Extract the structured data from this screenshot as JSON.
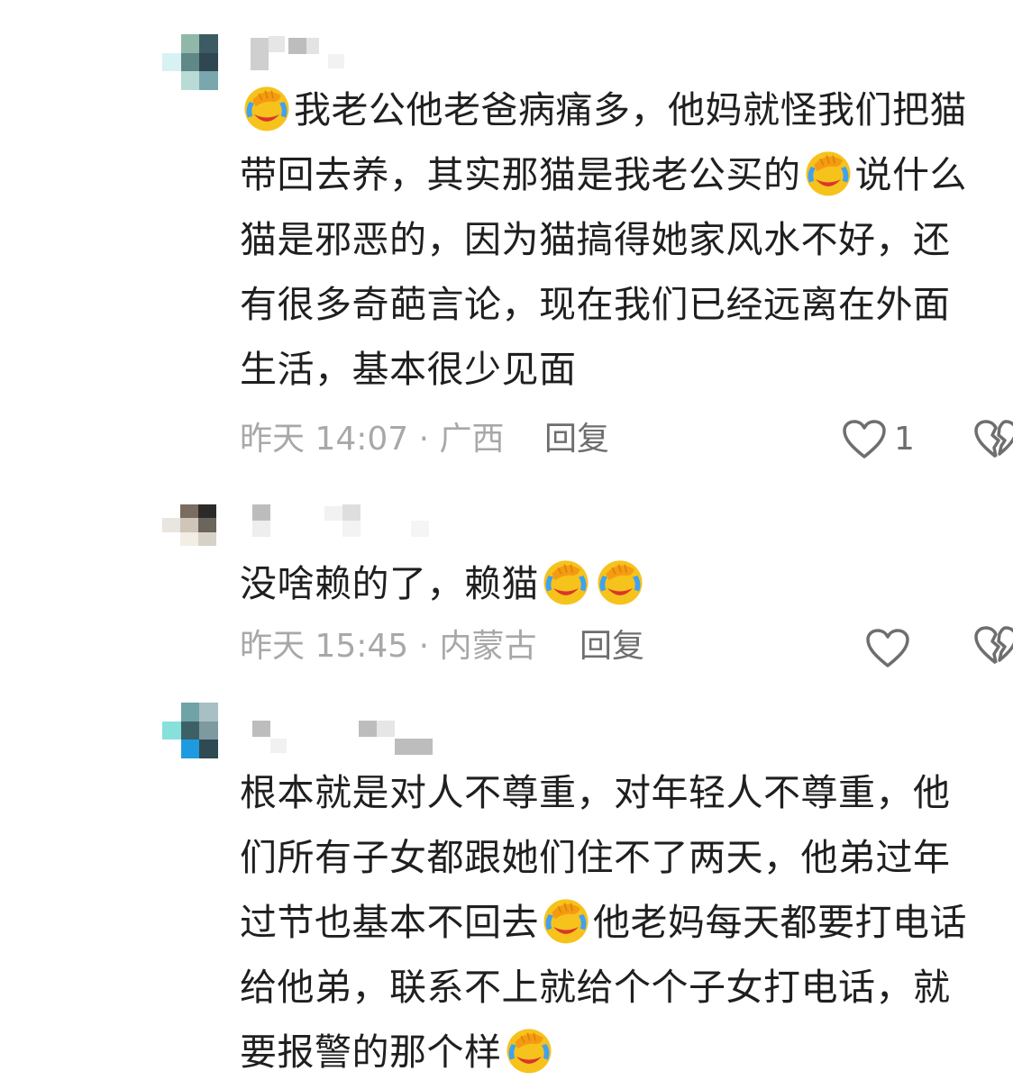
{
  "comments": [
    {
      "lines": [
        {
          "before": "",
          "emoji": "facepalm-laugh",
          "after": "我老公他老爸病痛多，他妈就怪我们把猫"
        },
        {
          "before": "带回去养，其实那猫是我老公买的",
          "emoji": "facepalm-laugh",
          "after": "说什么"
        },
        {
          "before": "猫是邪恶的，因为猫搞得她家风水不好，还",
          "emoji": "",
          "after": ""
        },
        {
          "before": "有很多奇葩言论，现在我们已经远离在外面",
          "emoji": "",
          "after": ""
        },
        {
          "before": "生活，基本很少见面",
          "emoji": "",
          "after": ""
        }
      ],
      "meta": "昨天 14:07 · 广西",
      "reply_label": "回复",
      "like_count": "1"
    },
    {
      "lines": [
        {
          "before": "没啥赖的了，赖猫",
          "emoji": "facepalm-laugh",
          "emoji2": "facepalm-laugh",
          "after": ""
        }
      ],
      "meta": "昨天 15:45 · 内蒙古",
      "reply_label": "回复",
      "like_count": ""
    },
    {
      "lines": [
        {
          "before": "根本就是对人不尊重，对年轻人不尊重，他",
          "emoji": "",
          "after": ""
        },
        {
          "before": "们所有子女都跟她们住不了两天，他弟过年",
          "emoji": "",
          "after": ""
        },
        {
          "before": "过节也基本不回去",
          "emoji": "facepalm-laugh",
          "after": "他老妈每天都要打电话"
        },
        {
          "before": "给他弟，联系不上就给个个子女打电话，就",
          "emoji": "",
          "after": ""
        },
        {
          "before": "要报警的那个样",
          "emoji": "facepalm-laugh",
          "after": ""
        }
      ]
    }
  ],
  "colors": {
    "text": "#1f1f1f",
    "meta": "#a8a8a8",
    "reply": "#6e6e6e",
    "icon": "#6e6e6e",
    "emoji_face": "#f6c21c",
    "emoji_hand": "#f59a12",
    "emoji_tear": "#3fa1f0",
    "emoji_mouth": "#d7372c"
  }
}
